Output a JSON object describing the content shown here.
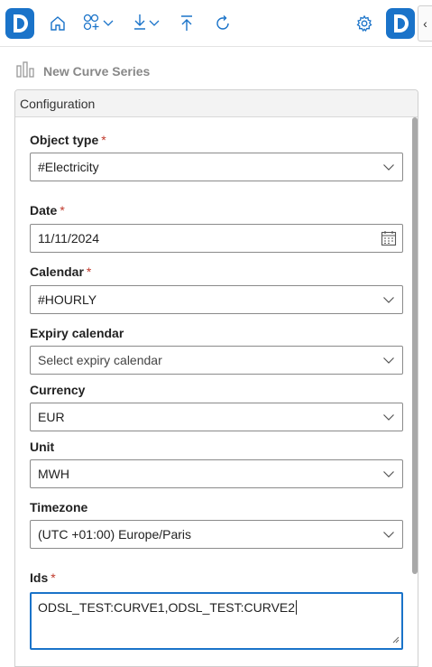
{
  "toolbar": {
    "icons": [
      "app-logo",
      "home-icon",
      "curve-add-icon",
      "download-icon",
      "upload-icon",
      "refresh-icon",
      "settings-icon",
      "brand-logo"
    ],
    "collapse_glyph": "‹"
  },
  "header": {
    "title": "New Curve Series"
  },
  "panel": {
    "title": "Configuration"
  },
  "form": {
    "object_type": {
      "label": "Object type",
      "required": "*",
      "value": "#Electricity"
    },
    "date": {
      "label": "Date",
      "required": "*",
      "value": "11/11/2024"
    },
    "calendar": {
      "label": "Calendar",
      "required": "*",
      "value": "#HOURLY"
    },
    "expiry_calendar": {
      "label": "Expiry calendar",
      "placeholder": "Select expiry calendar"
    },
    "currency": {
      "label": "Currency",
      "value": "EUR"
    },
    "unit": {
      "label": "Unit",
      "value": "MWH"
    },
    "timezone": {
      "label": "Timezone",
      "value": "(UTC +01:00) Europe/Paris"
    },
    "ids": {
      "label": "Ids",
      "required": "*",
      "value": "ODSL_TEST:CURVE1,ODSL_TEST:CURVE2"
    }
  },
  "colors": {
    "accent": "#1a73c9",
    "required": "#c0392b"
  }
}
